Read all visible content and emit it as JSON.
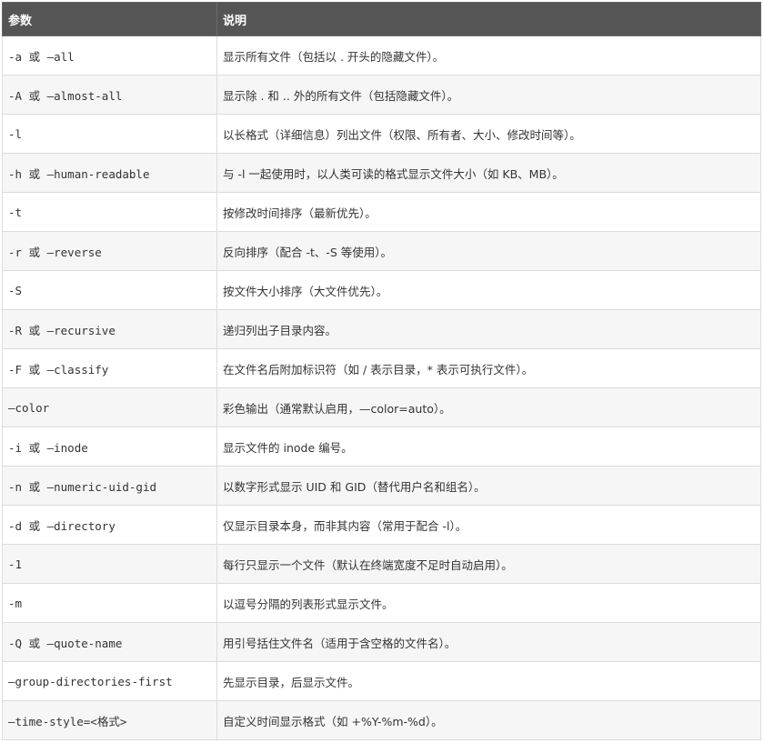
{
  "table": {
    "headers": [
      "参数",
      "说明"
    ],
    "rows": [
      {
        "param": "-a 或 —all",
        "desc": "显示所有文件（包括以 . 开头的隐藏文件）。"
      },
      {
        "param": "-A 或 —almost-all",
        "desc": "显示除 . 和 .. 外的所有文件（包括隐藏文件）。"
      },
      {
        "param": "-l",
        "desc": "以长格式（详细信息）列出文件（权限、所有者、大小、修改时间等）。"
      },
      {
        "param": "-h 或 —human-readable",
        "desc": "与 -l 一起使用时，以人类可读的格式显示文件大小（如 KB、MB）。"
      },
      {
        "param": "-t",
        "desc": "按修改时间排序（最新优先）。"
      },
      {
        "param": "-r 或 —reverse",
        "desc": "反向排序（配合 -t、-S 等使用）。"
      },
      {
        "param": "-S",
        "desc": "按文件大小排序（大文件优先）。"
      },
      {
        "param": "-R 或 —recursive",
        "desc": "递归列出子目录内容。"
      },
      {
        "param": "-F 或 —classify",
        "desc": "在文件名后附加标识符（如 / 表示目录，* 表示可执行文件）。"
      },
      {
        "param": "—color",
        "desc": "彩色输出（通常默认启用，—color=auto）。"
      },
      {
        "param": "-i 或 —inode",
        "desc": "显示文件的 inode 编号。"
      },
      {
        "param": "-n 或 —numeric-uid-gid",
        "desc": "以数字形式显示 UID 和 GID（替代用户名和组名）。"
      },
      {
        "param": "-d 或 —directory",
        "desc": "仅显示目录本身，而非其内容（常用于配合 -l）。"
      },
      {
        "param": "-1",
        "desc": "每行只显示一个文件（默认在终端宽度不足时自动启用）。"
      },
      {
        "param": "-m",
        "desc": "以逗号分隔的列表形式显示文件。"
      },
      {
        "param": "-Q 或 —quote-name",
        "desc": "用引号括住文件名（适用于含空格的文件名）。"
      },
      {
        "param": "—group-directories-first",
        "desc": "先显示目录，后显示文件。"
      },
      {
        "param": "—time-style=<格式>",
        "desc": "自定义时间显示格式（如 +%Y-%m-%d）。"
      }
    ]
  },
  "colors": {
    "header_bg": "#555555",
    "header_text": "#ffffff",
    "row_alt_bg": "#f6f6f6",
    "border": "#dcdcdc"
  }
}
